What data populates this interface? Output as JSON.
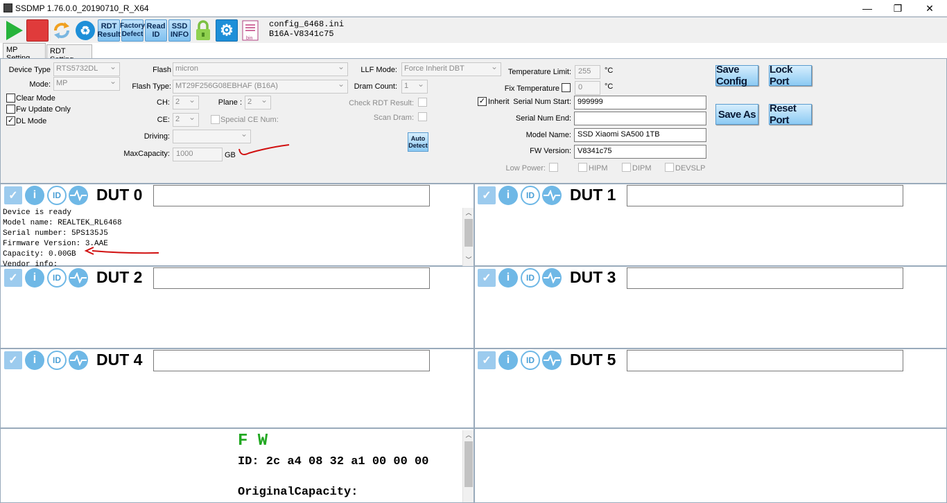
{
  "window": {
    "title": "SSDMP 1.76.0.0_20190710_R_X64",
    "minimize_glyph": "—",
    "restore_glyph": "❐",
    "close_glyph": "✕"
  },
  "toolbar": {
    "rdt_result": [
      "RDT",
      "Result"
    ],
    "factory_defect": [
      "Factory",
      "Defect"
    ],
    "read_id": [
      "Read",
      "ID"
    ],
    "ssd_info": [
      "SSD",
      "INFO"
    ],
    "config_file": "config_6468.ini",
    "config_version": "B16A-V8341c75",
    "bin_label": "bin"
  },
  "tabs": [
    "MP Setting",
    "RDT Setting"
  ],
  "settings": {
    "device_type_label": "Device Type",
    "device_type": "RTS5732DL",
    "mode_label": "Mode:",
    "mode": "MP",
    "clear_mode": "Clear Mode",
    "fw_update_only": "Fw Update Only",
    "dl_mode": "DL Mode",
    "flash_label": "Flash",
    "flash": "micron",
    "flash_type_label": "Flash Type:",
    "flash_type": "MT29F256G08EBHAF (B16A)",
    "ch_label": "CH:",
    "ch": "2",
    "plane_label": "Plane :",
    "plane": "2",
    "ce_label": "CE:",
    "ce": "2",
    "special_ce_num": "Special CE Num:",
    "driving_label": "Driving:",
    "driving": "",
    "max_capacity_label": "MaxCapacity:",
    "max_capacity": "1000",
    "max_capacity_unit": "GB",
    "llf_mode_label": "LLF Mode:",
    "llf_mode": "Force Inherit DBT",
    "dram_count_label": "Dram Count:",
    "dram_count": "1",
    "check_rdt_result": "Check RDT Result:",
    "scan_dram": "Scan Dram:",
    "auto_detect": [
      "Auto",
      "Detect"
    ],
    "temperature_limit_label": "Temperature Limit:",
    "temperature_limit": "255",
    "fix_temperature_label": "Fix Temperature",
    "fix_temperature": "0",
    "temp_unit": "°C",
    "inherit_label": "Inherit",
    "serial_num_start_label": "Serial Num Start:",
    "serial_num_start": "999999",
    "serial_num_end_label": "Serial Num End:",
    "serial_num_end": "",
    "model_name_label": "Model Name:",
    "model_name": "SSD Xiaomi SA500 1TB",
    "fw_version_label": "FW Version:",
    "fw_version": "V8341c75",
    "low_power_label": "Low Power:",
    "hipm": "HIPM",
    "dipm": "DIPM",
    "devslp": "DEVSLP",
    "save_config": "Save Config",
    "lock_port": "Lock Port",
    "save_as": "Save As",
    "reset_port": "Reset Port"
  },
  "duts": [
    {
      "label": "DUT 0",
      "log": "Device is ready\nModel name: REALTEK_RL6468\nSerial number: 5PS135J5\nFirmware Version: 3.AAE\nCapacity: 0.00GB\nVendor info:"
    },
    {
      "label": "DUT 1",
      "log": ""
    },
    {
      "label": "DUT 2",
      "log": ""
    },
    {
      "label": "DUT 3",
      "log": ""
    },
    {
      "label": "DUT 4",
      "log": ""
    },
    {
      "label": "DUT 5",
      "log": ""
    }
  ],
  "bottom_panel": {
    "fw_title": "F W",
    "id_line": "ID: 2c a4 08 32 a1 00 00 00",
    "original_capacity": "OriginalCapacity:"
  },
  "icons": {
    "check": "✓",
    "info": "i",
    "id": "ID"
  },
  "colors": {
    "accent_blue": "#6fb8e6",
    "fw_green": "#22a822",
    "annotation_red": "#d11010",
    "stop_red": "#e03b3b",
    "play_green": "#27b33b"
  }
}
